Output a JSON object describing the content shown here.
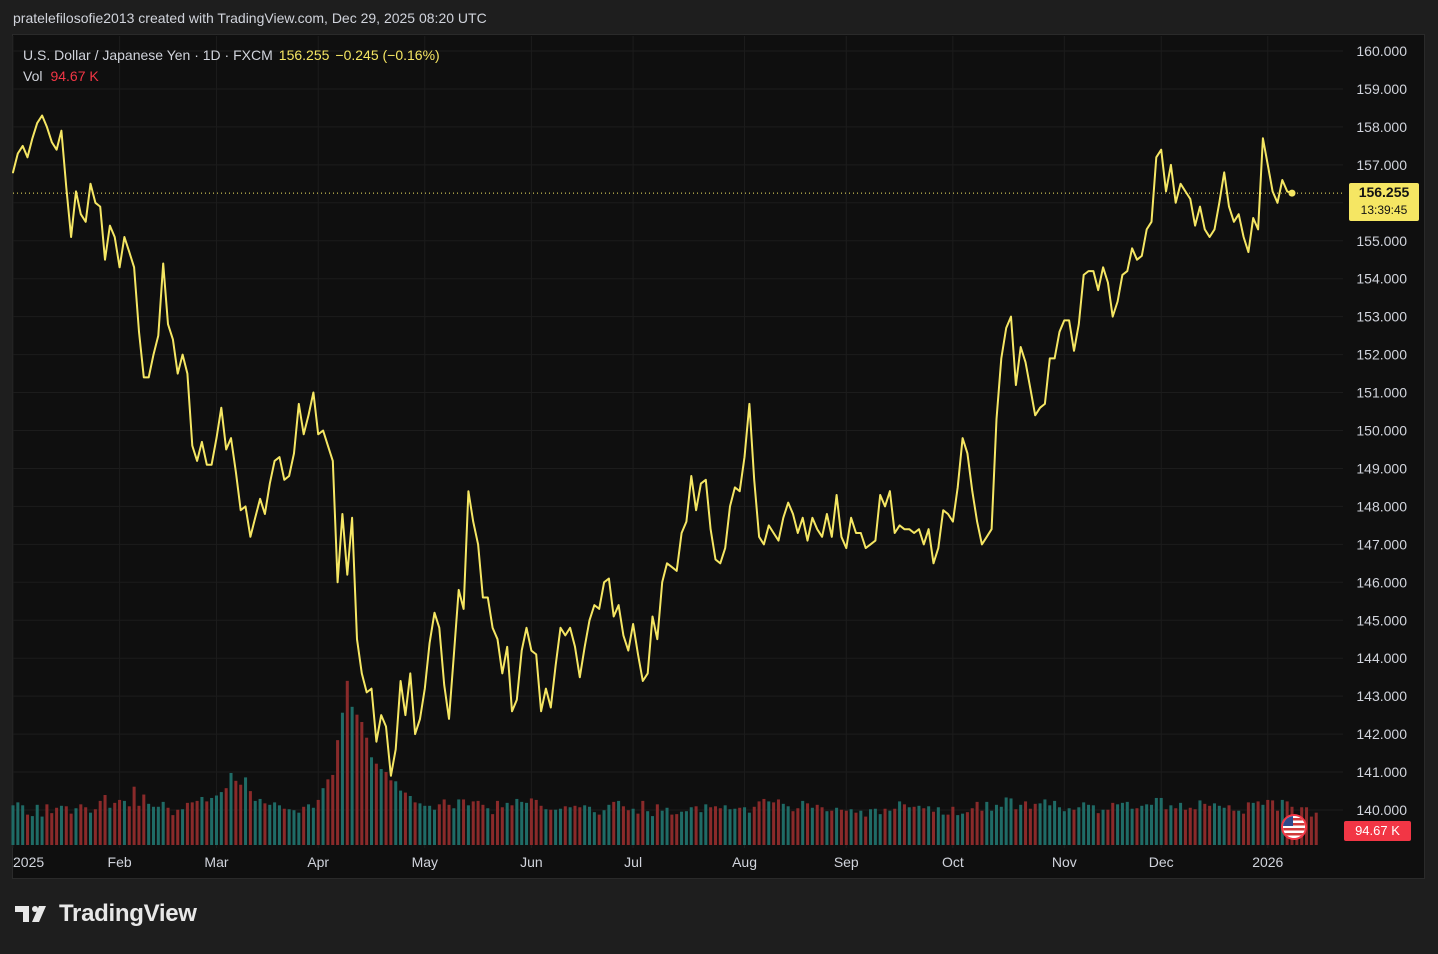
{
  "header": {
    "credit": "pratelefilosofie2013 created with TradingView.com, Dec 29, 2025 08:20 UTC"
  },
  "legend": {
    "symbol": "U.S. Dollar / Japanese Yen · 1D · FXCM",
    "last": "156.255",
    "change": "−0.245 (−0.16%)",
    "vol_label": "Vol",
    "vol_value": "94.67 K"
  },
  "badges": {
    "price": "156.255",
    "countdown": "13:39:45",
    "volume": "94.67 K"
  },
  "branding": {
    "logo_text": "TradingView"
  },
  "colors": {
    "line": "#f5e663",
    "vol_up": "#1f6b66",
    "vol_down": "#8a2a2a",
    "grid": "#1c1c1c",
    "background": "#0f0f0f"
  },
  "chart_data": {
    "type": "line",
    "title": "U.S. Dollar / Japanese Yen · 1D · FXCM",
    "xlabel": "",
    "ylabel": "",
    "ylim": [
      139.6,
      160.2
    ],
    "yticks": [
      140,
      141,
      142,
      143,
      144,
      145,
      146,
      147,
      148,
      149,
      150,
      151,
      152,
      153,
      154,
      155,
      156,
      157,
      158,
      159,
      160
    ],
    "ytick_labels": [
      "140.000",
      "141.000",
      "142.000",
      "143.000",
      "144.000",
      "145.000",
      "146.000",
      "147.000",
      "148.000",
      "149.000",
      "150.000",
      "151.000",
      "152.000",
      "153.000",
      "154.000",
      "155.000",
      "156.000",
      "157.000",
      "158.000",
      "159.000",
      "160.000"
    ],
    "xticks": [
      {
        "label": "2025",
        "index": 0
      },
      {
        "label": "Feb",
        "index": 22
      },
      {
        "label": "Mar",
        "index": 42
      },
      {
        "label": "Apr",
        "index": 63
      },
      {
        "label": "May",
        "index": 85
      },
      {
        "label": "Jun",
        "index": 107
      },
      {
        "label": "Jul",
        "index": 128
      },
      {
        "label": "Aug",
        "index": 151
      },
      {
        "label": "Sep",
        "index": 172
      },
      {
        "label": "Oct",
        "index": 194
      },
      {
        "label": "Nov",
        "index": 217
      },
      {
        "label": "Dec",
        "index": 237
      },
      {
        "label": "2026",
        "index": 259
      }
    ],
    "last_value": 156.255,
    "grid": true,
    "series": [
      {
        "name": "",
        "values": [
          156.8,
          157.3,
          157.5,
          157.2,
          157.7,
          158.1,
          158.3,
          158.0,
          157.6,
          157.4,
          157.9,
          156.4,
          155.1,
          156.3,
          155.7,
          155.5,
          156.5,
          156.0,
          155.9,
          154.5,
          155.4,
          155.1,
          154.3,
          155.1,
          154.7,
          154.3,
          152.6,
          151.4,
          151.4,
          152.0,
          152.5,
          154.4,
          152.8,
          152.4,
          151.5,
          152.0,
          151.5,
          149.6,
          149.2,
          149.7,
          149.1,
          149.1,
          149.8,
          150.6,
          149.5,
          149.8,
          148.9,
          147.9,
          148.0,
          147.2,
          147.7,
          148.2,
          147.8,
          148.6,
          149.2,
          149.3,
          148.7,
          148.8,
          149.4,
          150.7,
          149.9,
          150.4,
          151.0,
          149.9,
          150.0,
          149.6,
          149.2,
          146.0,
          147.8,
          146.2,
          147.7,
          144.5,
          143.6,
          143.1,
          143.2,
          141.8,
          142.5,
          142.2,
          140.9,
          141.6,
          143.4,
          142.5,
          143.6,
          142.0,
          142.4,
          143.2,
          144.4,
          145.2,
          144.8,
          143.3,
          142.4,
          144.1,
          145.8,
          145.3,
          148.4,
          147.6,
          147.0,
          145.6,
          145.6,
          144.8,
          144.5,
          143.6,
          144.3,
          142.6,
          142.9,
          144.2,
          144.8,
          144.2,
          144.1,
          142.6,
          143.2,
          142.7,
          143.8,
          144.8,
          144.6,
          144.8,
          144.3,
          143.5,
          144.3,
          145.0,
          145.4,
          145.3,
          146.0,
          146.1,
          145.1,
          145.4,
          144.6,
          144.2,
          144.9,
          144.1,
          143.4,
          143.6,
          145.1,
          144.5,
          146.0,
          146.5,
          146.4,
          146.3,
          147.3,
          147.6,
          148.8,
          147.9,
          148.6,
          148.7,
          147.4,
          146.6,
          146.5,
          146.9,
          148.0,
          148.5,
          148.4,
          149.3,
          150.7,
          148.7,
          147.2,
          147.0,
          147.5,
          147.3,
          147.1,
          147.7,
          148.1,
          147.8,
          147.3,
          147.7,
          147.1,
          147.7,
          147.4,
          147.2,
          147.8,
          147.2,
          148.3,
          147.2,
          146.9,
          147.7,
          147.3,
          147.3,
          146.9,
          147.0,
          147.1,
          148.3,
          148.0,
          148.4,
          147.3,
          147.5,
          147.4,
          147.4,
          147.3,
          147.4,
          147.0,
          147.4,
          146.5,
          146.9,
          147.9,
          147.8,
          147.6,
          148.5,
          149.8,
          149.4,
          148.4,
          147.6,
          147.0,
          147.2,
          147.4,
          150.3,
          151.9,
          152.7,
          153.0,
          151.2,
          152.2,
          151.8,
          151.1,
          150.4,
          150.6,
          150.7,
          151.9,
          151.9,
          152.6,
          152.9,
          152.9,
          152.1,
          152.8,
          154.1,
          154.2,
          154.2,
          153.7,
          154.3,
          153.9,
          153.0,
          153.4,
          154.1,
          154.2,
          154.8,
          154.5,
          154.6,
          155.3,
          155.5,
          157.2,
          157.4,
          156.3,
          157.0,
          156.0,
          156.5,
          156.3,
          156.1,
          155.4,
          155.9,
          155.3,
          155.1,
          155.3,
          156.0,
          156.8,
          155.9,
          155.5,
          155.7,
          155.1,
          154.7,
          155.6,
          155.3,
          157.7,
          157.0,
          156.3,
          156.0,
          156.6,
          156.3,
          156.255
        ]
      }
    ],
    "volume": {
      "name": "Vol",
      "last": 94.67,
      "max_k": 500,
      "values_k": [
        81,
        87,
        81,
        62,
        59,
        82,
        58,
        83,
        65,
        76,
        80,
        79,
        64,
        75,
        83,
        77,
        66,
        73,
        90,
        102,
        76,
        86,
        92,
        90,
        79,
        119,
        80,
        103,
        84,
        78,
        78,
        88,
        76,
        61,
        72,
        73,
        86,
        87,
        90,
        98,
        89,
        96,
        101,
        108,
        116,
        147,
        131,
        123,
        138,
        110,
        90,
        94,
        85,
        82,
        87,
        81,
        74,
        73,
        71,
        66,
        78,
        83,
        76,
        92,
        116,
        134,
        143,
        214,
        270,
        335,
        282,
        266,
        251,
        219,
        179,
        166,
        155,
        149,
        132,
        130,
        111,
        107,
        100,
        87,
        85,
        80,
        80,
        72,
        83,
        93,
        82,
        75,
        93,
        93,
        81,
        89,
        90,
        82,
        75,
        63,
        90,
        77,
        86,
        81,
        94,
        88,
        86,
        95,
        92,
        80,
        73,
        72,
        72,
        74,
        79,
        77,
        80,
        77,
        81,
        78,
        67,
        62,
        71,
        82,
        88,
        90,
        79,
        71,
        74,
        64,
        90,
        69,
        59,
        83,
        70,
        76,
        62,
        63,
        68,
        69,
        77,
        79,
        67,
        83,
        77,
        79,
        75,
        81,
        73,
        74,
        76,
        77,
        66,
        78,
        89,
        94,
        89,
        87,
        93,
        84,
        79,
        69,
        75,
        90,
        85,
        76,
        82,
        77,
        69,
        70,
        76,
        72,
        70,
        73,
        66,
        70,
        58,
        73,
        74,
        63,
        74,
        70,
        74,
        89,
        83,
        77,
        78,
        80,
        75,
        79,
        68,
        77,
        62,
        62,
        78,
        61,
        64,
        67,
        75,
        88,
        70,
        88,
        70,
        82,
        78,
        97,
        95,
        73,
        82,
        89,
        74,
        84,
        85,
        93,
        81,
        90,
        77,
        69,
        75,
        72,
        77,
        87,
        82,
        81,
        65,
        72,
        72,
        86,
        83,
        86,
        88,
        74,
        75,
        80,
        83,
        82,
        96,
        96,
        73,
        81,
        75,
        86,
        72,
        76,
        73,
        91,
        84,
        80,
        85,
        80,
        76,
        81,
        70,
        70,
        64,
        87,
        86,
        89,
        82,
        92,
        91,
        70,
        92,
        89,
        78,
        59,
        77,
        77,
        58,
        66
      ]
    }
  }
}
